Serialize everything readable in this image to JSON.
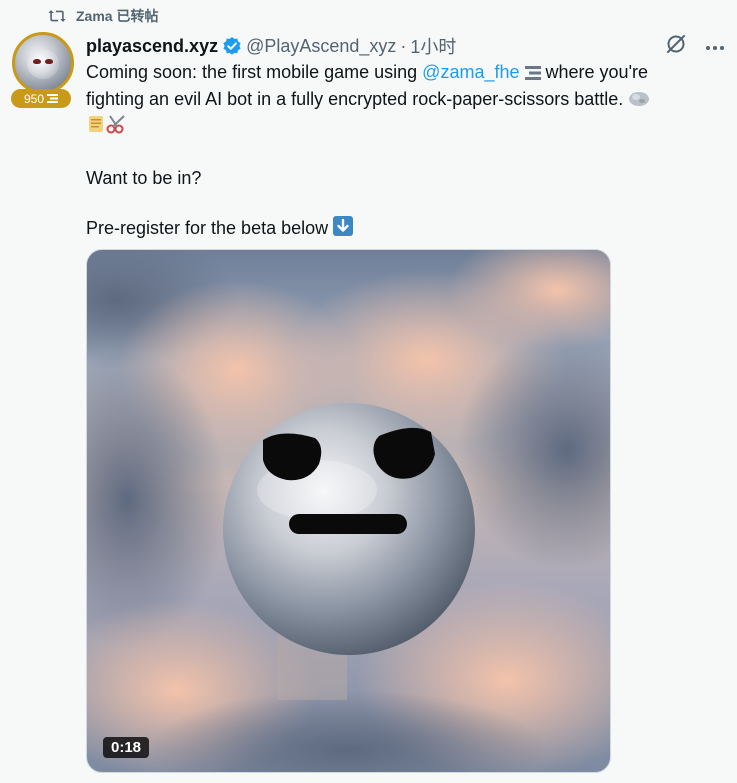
{
  "retweet": {
    "icon": "retweet-icon",
    "text": "Zama 已转帖"
  },
  "author": {
    "display_name": "playascend.xyz",
    "handle": "@PlayAscend_xyz",
    "separator": "·",
    "timestamp": "1小时",
    "badge_score": "950",
    "badge_color": "#c99a17",
    "verified_color": "#1d9bf0"
  },
  "tweet": {
    "line1_before": "Coming soon: the first mobile game using ",
    "mention": "@zama_fhe",
    "line1_after": " where you're",
    "line2": "fighting an evil AI bot in a fully encrypted rock-paper-scissors battle. ",
    "line5": "Want to be in?",
    "line7": "Pre-register for the beta below "
  },
  "media": {
    "duration": "0:18"
  },
  "colors": {
    "text": "#0f1419",
    "secondary": "#536471",
    "link": "#1d9bf0",
    "background": "#f7f9f9"
  }
}
